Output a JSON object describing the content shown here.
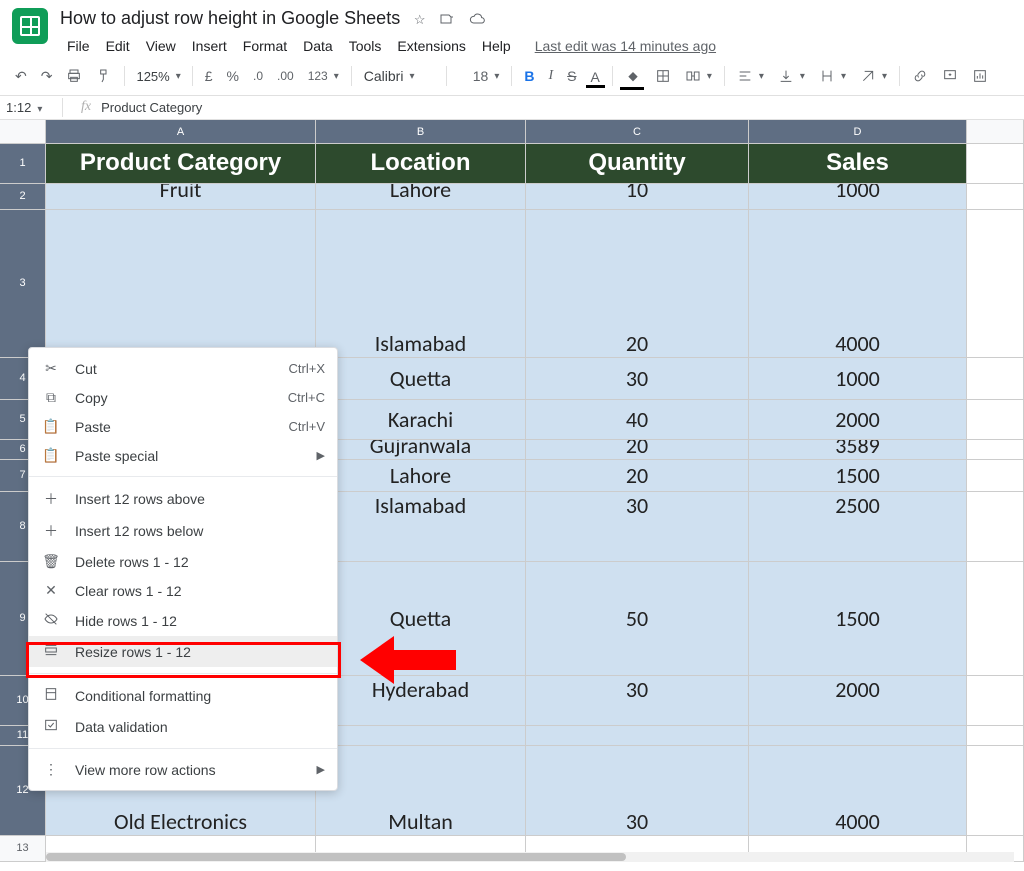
{
  "doc": {
    "title": "How to adjust row height in Google Sheets",
    "last_edit": "Last edit was 14 minutes ago"
  },
  "menus": [
    "File",
    "Edit",
    "View",
    "Insert",
    "Format",
    "Data",
    "Tools",
    "Extensions",
    "Help"
  ],
  "toolbar": {
    "zoom": "125%",
    "currency": "£",
    "percent": "%",
    "dec_dec": ".0",
    "inc_dec": ".00",
    "numfmt": "123",
    "font": "Calibri",
    "size": "18",
    "bold": "B",
    "italic": "I",
    "strike": "S",
    "textcolor": "A"
  },
  "namebox": {
    "range": "1:12",
    "fx": "fx",
    "value": "Product Category"
  },
  "columns": {
    "A": "A",
    "B": "B",
    "C": "C",
    "D": "D",
    "E": ""
  },
  "rows": [
    "1",
    "2",
    "3",
    "4",
    "5",
    "6",
    "7",
    "8",
    "9",
    "10",
    "11",
    "12",
    "13"
  ],
  "headers": {
    "A": "Product Category",
    "B": "Location",
    "C": "Quantity",
    "D": "Sales"
  },
  "data": {
    "r2": [
      "Fruit",
      "Lahore",
      "10",
      "1000"
    ],
    "r3": [
      "",
      "Islamabad",
      "20",
      "4000"
    ],
    "r4": [
      "",
      "Quetta",
      "30",
      "1000"
    ],
    "r5": [
      "",
      "Karachi",
      "40",
      "2000"
    ],
    "r6": [
      "",
      "Gujranwala",
      "20",
      "3589"
    ],
    "r7": [
      "",
      "Lahore",
      "20",
      "1500"
    ],
    "r8": [
      "",
      "Islamabad",
      "30",
      "2500"
    ],
    "r9": [
      "",
      "Quetta",
      "50",
      "1500"
    ],
    "r10": [
      "",
      "Hyderabad",
      "30",
      "2000"
    ],
    "r11": [
      "",
      "",
      "",
      ""
    ],
    "r12": [
      "Old Electronics",
      "Multan",
      "30",
      "4000"
    ]
  },
  "context_menu": {
    "cut": "Cut",
    "cut_sc": "Ctrl+X",
    "copy": "Copy",
    "copy_sc": "Ctrl+C",
    "paste": "Paste",
    "paste_sc": "Ctrl+V",
    "paste_special": "Paste special",
    "insert_above": "Insert 12 rows above",
    "insert_below": "Insert 12 rows below",
    "delete": "Delete rows 1 - 12",
    "clear": "Clear rows 1 - 12",
    "hide": "Hide rows 1 - 12",
    "resize": "Resize rows 1 - 12",
    "cond_fmt": "Conditional formatting",
    "data_val": "Data validation",
    "more": "View more row actions"
  }
}
